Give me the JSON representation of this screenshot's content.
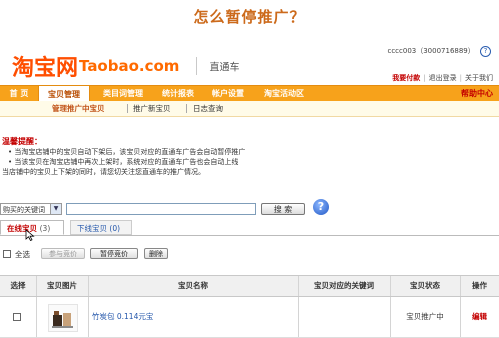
{
  "page_title": "怎么暂停推广？",
  "header": {
    "logo_cn": "淘宝网",
    "logo_en": "Taobao.com",
    "product": "直通车",
    "account": "cccc003（3000716889）",
    "help_icon": "question-icon",
    "links": [
      "我要付款",
      "退出登录",
      "关于我们"
    ]
  },
  "nav": {
    "tabs": [
      "首 页",
      "宝贝管理",
      "类目词管理",
      "统计报表",
      "帐户设置",
      "淘宝活动区"
    ],
    "help": "帮助中心"
  },
  "subnav": {
    "items": [
      "管理推广中宝贝",
      "推广新宝贝",
      "日志查询"
    ]
  },
  "tips": {
    "title": "温馨提醒：",
    "lines": [
      "• 当淘宝店铺中的宝贝自动下架后，该宝贝对应的直通车广告会自动暂停推广",
      "• 当该宝贝在淘宝店铺中再次上架时，系统对应的直通车广告也会自动上线",
      "当店铺中的宝贝上下架的同时，请您切关注您直通车的推广情况。"
    ]
  },
  "search": {
    "select_value": "购买的关键词",
    "input_value": "",
    "button": "搜 索",
    "help_glyph": "?"
  },
  "tabs": [
    {
      "label": "在线宝贝",
      "count": "(3)"
    },
    {
      "label": "下线宝贝",
      "count": "(0)"
    }
  ],
  "actions": {
    "select_all": "全选",
    "buttons": [
      "参与竞价",
      "暂停竞价",
      "删除"
    ]
  },
  "table": {
    "headers": [
      "选择",
      "宝贝图片",
      "宝贝名称",
      "宝贝对应的关键词",
      "宝贝状态",
      "操作"
    ],
    "rows": [
      {
        "name": "竹炭包 0.114元宝",
        "keyword": "",
        "status": "宝贝推广中",
        "action": "编辑"
      }
    ]
  }
}
